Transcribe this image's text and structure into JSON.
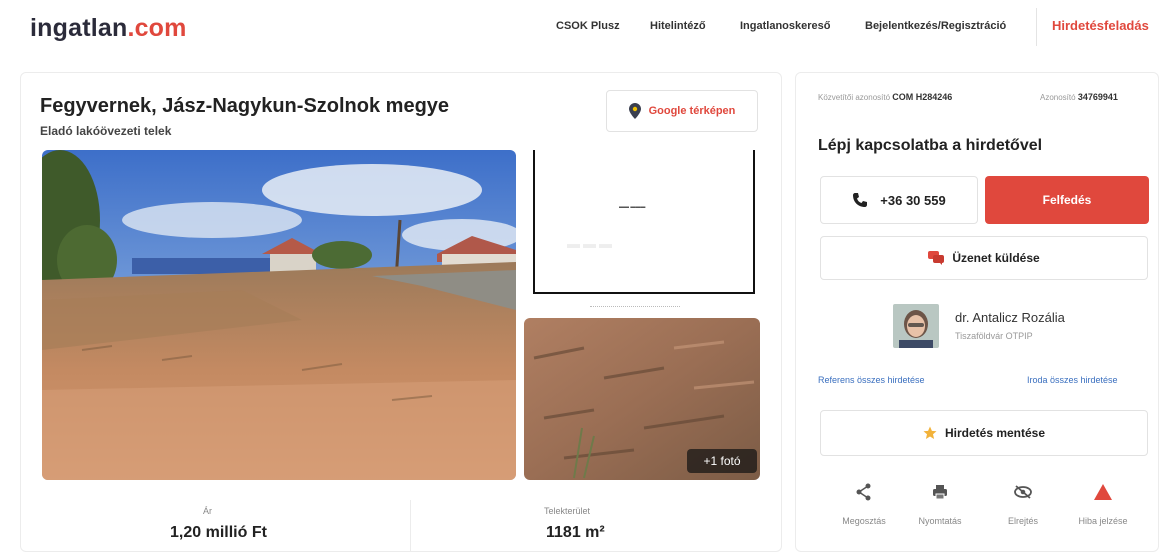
{
  "header": {
    "logo_main": "ingatlan",
    "logo_tld": ".com",
    "nav": [
      "CSOK Plusz",
      "Hitelintéző",
      "Ingatlanoskereső",
      "Bejelentkezés/Regisztráció"
    ],
    "cta": "Hirdetésfeladás"
  },
  "listing": {
    "title": "Fegyvernek, Jász-Nagykun-Szolnok megye",
    "subtitle": "Eladó lakóövezeti telek",
    "map_button": "Google térképen",
    "more_photos": "+1 fotó",
    "price_label": "Ár",
    "price_value": "1,20 millió Ft",
    "area_label": "Telekterület",
    "area_value": "1181 m²"
  },
  "contact": {
    "agency_id_label": "Közvetítői azonosító",
    "agency_id": "COM H284246",
    "listing_id_label": "Azonosító",
    "listing_id": "34769941",
    "title": "Lépj kapcsolatba a hirdetővel",
    "phone": "+36 30 559",
    "reveal": "Felfedés",
    "message": "Üzenet küldése",
    "agent_name": "dr. Antalicz Rozália",
    "agent_office": "Tiszaföldvár OTPIP",
    "agent_link": "Referens összes hirdetése",
    "office_link": "Iroda összes hirdetése",
    "save": "Hirdetés mentése"
  },
  "actions": [
    {
      "label": "Megosztás",
      "icon": "share-icon"
    },
    {
      "label": "Nyomtatás",
      "icon": "print-icon"
    },
    {
      "label": "Elrejtés",
      "icon": "hide-icon"
    },
    {
      "label": "Hiba jelzése",
      "icon": "warning-icon"
    }
  ],
  "colors": {
    "accent": "#e0483d",
    "link": "#3a6fbf"
  }
}
